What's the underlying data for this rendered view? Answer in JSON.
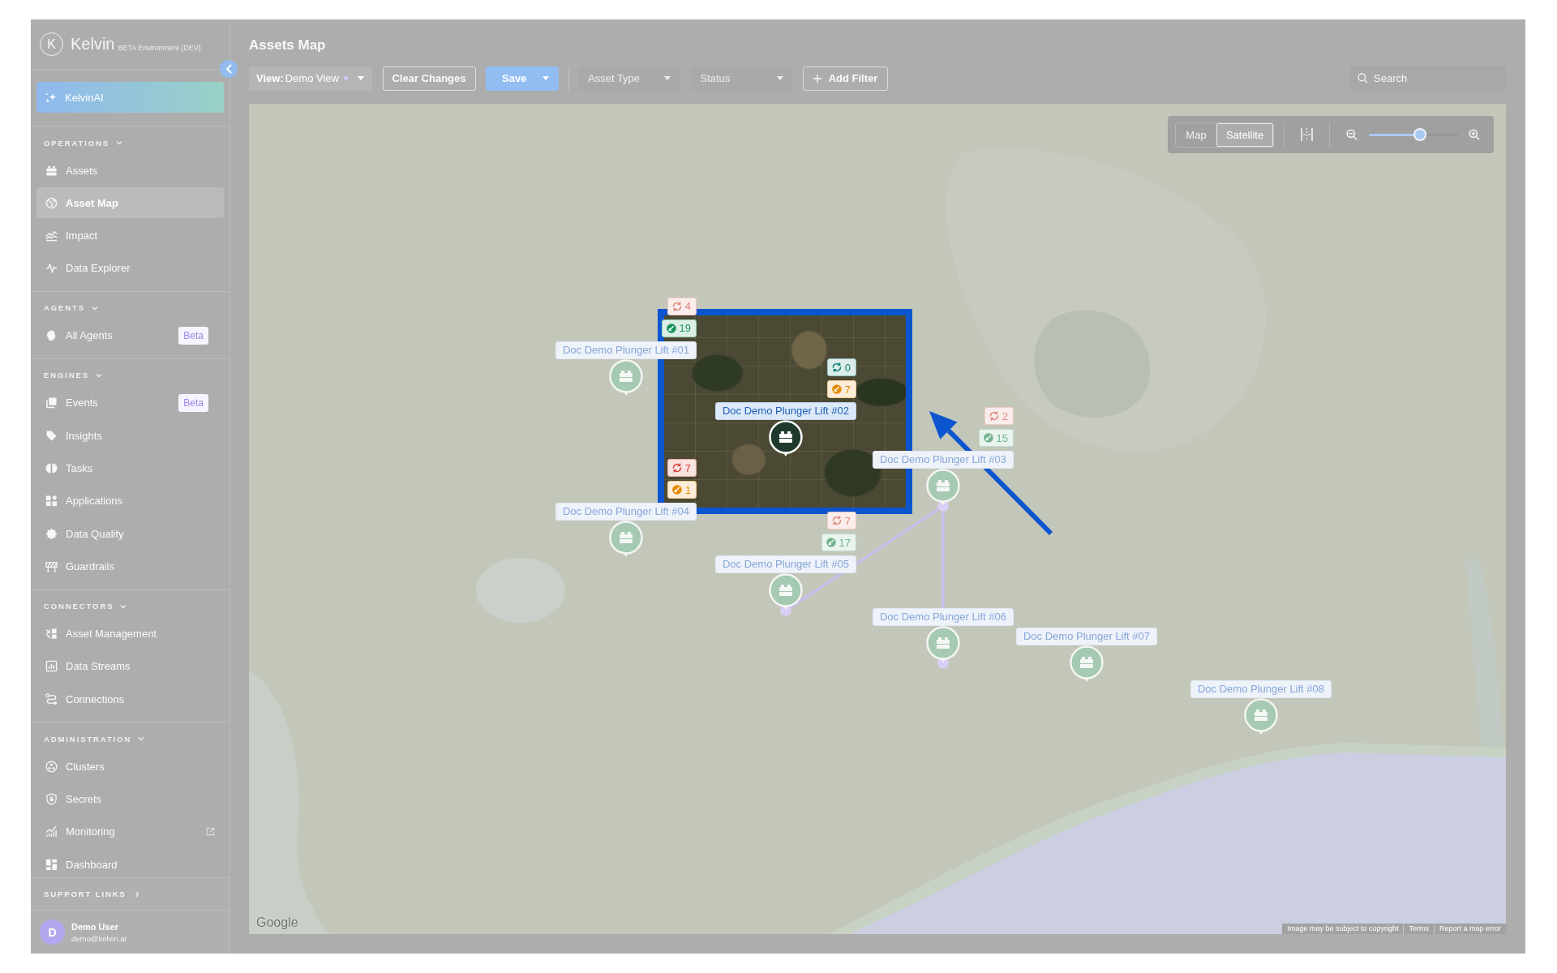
{
  "app": {
    "logo": {
      "mark": "K",
      "name": "Kelvin",
      "environment": "BETA Environment (DEV)"
    }
  },
  "sidebar": {
    "ai_button": {
      "label": "KelvinAI"
    },
    "sections": [
      {
        "title": "OPERATIONS",
        "expanded": true,
        "items": [
          {
            "label": "Assets",
            "selected": false,
            "external": false
          },
          {
            "label": "Asset Map",
            "selected": true,
            "external": false
          },
          {
            "label": "Impact",
            "selected": false,
            "external": false
          },
          {
            "label": "Data Explorer",
            "selected": false,
            "external": false
          }
        ]
      },
      {
        "title": "AGENTS",
        "expanded": true,
        "items": [
          {
            "label": "All Agents",
            "badge": "Beta",
            "selected": false,
            "external": false
          }
        ]
      },
      {
        "title": "ENGINES",
        "expanded": true,
        "items": [
          {
            "label": "Events",
            "badge": "Beta",
            "selected": false,
            "external": false
          },
          {
            "label": "Insights",
            "selected": false,
            "external": false
          },
          {
            "label": "Tasks",
            "selected": false,
            "external": false
          },
          {
            "label": "Applications",
            "selected": false,
            "external": false
          },
          {
            "label": "Data Quality",
            "selected": false,
            "external": false
          },
          {
            "label": "Guardrails",
            "selected": false,
            "external": false
          }
        ]
      },
      {
        "title": "CONNECTORS",
        "expanded": true,
        "items": [
          {
            "label": "Asset Management",
            "selected": false,
            "external": false
          },
          {
            "label": "Data Streams",
            "selected": false,
            "external": false
          },
          {
            "label": "Connections",
            "selected": false,
            "external": false
          }
        ]
      },
      {
        "title": "ADMINISTRATION",
        "expanded": true,
        "items": [
          {
            "label": "Clusters",
            "selected": false,
            "external": false
          },
          {
            "label": "Secrets",
            "selected": false,
            "external": false
          },
          {
            "label": "Monitoring",
            "selected": false,
            "external": true
          },
          {
            "label": "Dashboard",
            "selected": false,
            "external": false
          }
        ]
      }
    ],
    "support_links": {
      "title": "SUPPORT LINKS",
      "expanded": false
    },
    "user": {
      "initial": "D",
      "name": "Demo User",
      "email": "demo@kelvin.ai"
    }
  },
  "page": {
    "title": "Assets Map"
  },
  "toolbar": {
    "view_select": {
      "label": "View:",
      "value": "Demo View",
      "modified": true
    },
    "clear_button": {
      "label": "Clear Changes"
    },
    "save_button": {
      "label": "Save"
    },
    "filters": [
      {
        "placeholder": "Asset Type",
        "disabled": true
      },
      {
        "placeholder": "Status",
        "disabled": true
      }
    ],
    "add_filter_button": {
      "label": "Add Filter"
    },
    "search": {
      "placeholder": "Search"
    }
  },
  "map": {
    "types": [
      {
        "label": "Map",
        "selected": false
      },
      {
        "label": "Satellite",
        "selected": true
      }
    ],
    "zoom": {
      "level": 0.59
    },
    "assets": [
      {
        "name": "Doc Demo Plunger Lift #01",
        "highlighted": false,
        "badges": [
          {
            "kind": "cycle",
            "count": "4",
            "color": "#df8a7e"
          },
          {
            "kind": "gauge",
            "count": "19",
            "color": "#17935a"
          }
        ]
      },
      {
        "name": "Doc Demo Plunger Lift #02",
        "highlighted": true,
        "badges": [
          {
            "kind": "cycle",
            "count": "0",
            "color": "#0f7f76"
          },
          {
            "kind": "gauge",
            "count": "7",
            "color": "#e58a00"
          }
        ]
      },
      {
        "name": "Doc Demo Plunger Lift #03",
        "highlighted": false,
        "badges": [
          {
            "kind": "cycle",
            "count": "2",
            "color": "#df8a7e"
          },
          {
            "kind": "gauge",
            "count": "15",
            "color": "#72b58e"
          }
        ]
      },
      {
        "name": "Doc Demo Plunger Lift #04",
        "highlighted": false,
        "badges": [
          {
            "kind": "cycle",
            "count": "7",
            "color": "#d8413a"
          },
          {
            "kind": "gauge",
            "count": "1",
            "color": "#e58a00"
          }
        ]
      },
      {
        "name": "Doc Demo Plunger Lift #05",
        "highlighted": false,
        "badges": [
          {
            "kind": "cycle",
            "count": "7",
            "color": "#df8a7e"
          },
          {
            "kind": "gauge",
            "count": "17",
            "color": "#72b58e"
          }
        ]
      },
      {
        "name": "Doc Demo Plunger Lift #06",
        "highlighted": false
      },
      {
        "name": "Doc Demo Plunger Lift #07",
        "highlighted": false
      },
      {
        "name": "Doc Demo Plunger Lift #08",
        "highlighted": false
      }
    ],
    "logo": "Google",
    "attribution": [
      "Image may be subject to copyright",
      "Terms",
      "Report a map error"
    ]
  }
}
